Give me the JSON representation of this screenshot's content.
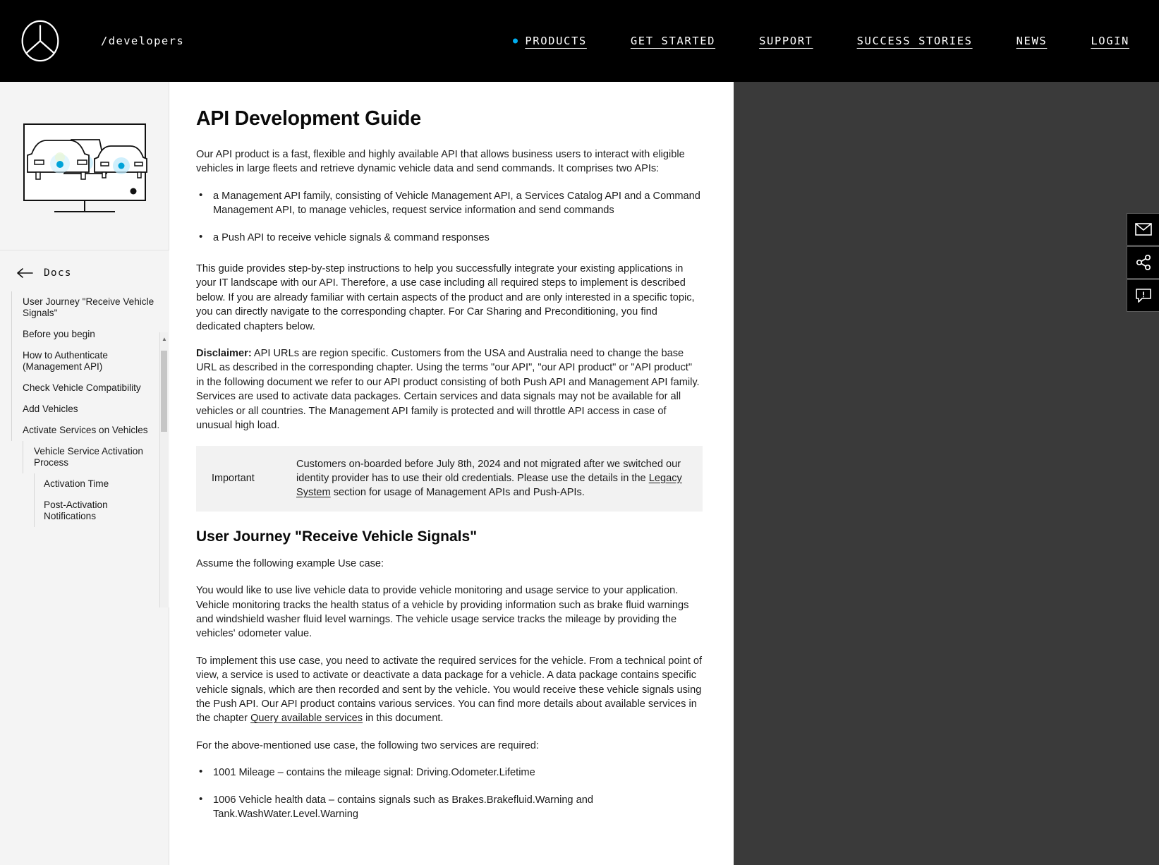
{
  "header": {
    "logo_name": "mercedes-benz-star-logo",
    "brand_text": "/developers",
    "nav": [
      {
        "label": "PRODUCTS",
        "active": true
      },
      {
        "label": "GET STARTED",
        "active": false
      },
      {
        "label": "SUPPORT",
        "active": false
      },
      {
        "label": "SUCCESS STORIES",
        "active": false
      },
      {
        "label": "NEWS",
        "active": false
      },
      {
        "label": "LOGIN",
        "active": false
      }
    ],
    "accent_color": "#00adef",
    "background_color": "#000000"
  },
  "sidebar": {
    "illustration_name": "fleet-vehicles-monitor-illustration",
    "back_label": "Docs",
    "toc": [
      {
        "label": "User Journey \"Receive Vehicle Signals\"",
        "level": 1
      },
      {
        "label": "Before you begin",
        "level": 1
      },
      {
        "label": "How to Authenticate (Management API)",
        "level": 1
      },
      {
        "label": "Check Vehicle Compatibility",
        "level": 1
      },
      {
        "label": "Add Vehicles",
        "level": 1
      },
      {
        "label": "Activate Services on Vehicles",
        "level": 1
      },
      {
        "label": "Vehicle Service Activation Process",
        "level": 2
      },
      {
        "label": "Activation Time",
        "level": 3
      },
      {
        "label": "Post-Activation Notifications",
        "level": 3
      }
    ]
  },
  "document": {
    "title": "API Development Guide",
    "intro": "Our API product is a fast, flexible and highly available API that allows business users to interact with eligible vehicles in large fleets and retrieve dynamic vehicle data and send commands. It comprises two APIs:",
    "api_list": [
      "a Management API family, consisting of Vehicle Management API, a Services Catalog API and a Command Management API, to manage vehicles, request service information and send commands",
      "a Push API to receive vehicle signals & command responses"
    ],
    "guide_paragraph": "This guide provides step-by-step instructions to help you successfully integrate your existing applications in your IT landscape with our API. Therefore, a use case including all required steps to implement is described below. If you are already familiar with certain aspects of the product and are only interested in a specific topic, you can directly navigate to the corresponding chapter. For Car Sharing and Preconditioning, you find dedicated chapters below.",
    "disclaimer_label": "Disclaimer:",
    "disclaimer_text": " API URLs are region specific. Customers from the USA and Australia need to change the base URL as described in the corresponding chapter. Using the terms \"our API\", \"our API product\" or \"API product\" in the following document we refer to our API product consisting of both Push API and Management API family. Services are used to activate data packages. Certain services and data signals may not be available for all vehicles or all countries. The Management API family is protected and will throttle API access in case of unusual high load.",
    "callout": {
      "label": "Important",
      "text_before_link": "Customers on-boarded before July 8th, 2024 and not migrated after we switched our identity provider has to use their old credentials. Please use the details in the ",
      "link_text": "Legacy System",
      "text_after_link": " section for usage of Management APIs and Push-APIs."
    },
    "section_heading": "User Journey \"Receive Vehicle Signals\"",
    "assume_line": "Assume the following example Use case:",
    "use_case_paragraph": "You would like to use live vehicle data to provide vehicle monitoring and usage service to your application. Vehicle monitoring tracks the health status of a vehicle by providing information such as brake fluid warnings and windshield washer fluid level warnings. The vehicle usage service tracks the mileage by providing the vehicles' odometer value.",
    "implement_before_link": "To implement this use case, you need to activate the required services for the vehicle. From a technical point of view, a service is used to activate or deactivate a data package for a vehicle. A data package contains specific vehicle signals, which are then recorded and sent by the vehicle. You would receive these vehicle signals using the Push API. Our API product contains various services. You can find more details about available services in the chapter ",
    "implement_link": "Query available services",
    "implement_after_link": " in this document.",
    "services_intro": "For the above-mentioned use case, the following two services are required:",
    "services_list": [
      "1001 Mileage – contains the mileage signal: Driving.Odometer.Lifetime",
      "1006 Vehicle health data – contains signals such as Brakes.Brakefluid.Warning and Tank.WashWater.Level.Warning"
    ]
  },
  "float_buttons": [
    {
      "name": "mail-icon",
      "label": "Contact"
    },
    {
      "name": "share-icon",
      "label": "Share"
    },
    {
      "name": "feedback-icon",
      "label": "Feedback"
    }
  ]
}
